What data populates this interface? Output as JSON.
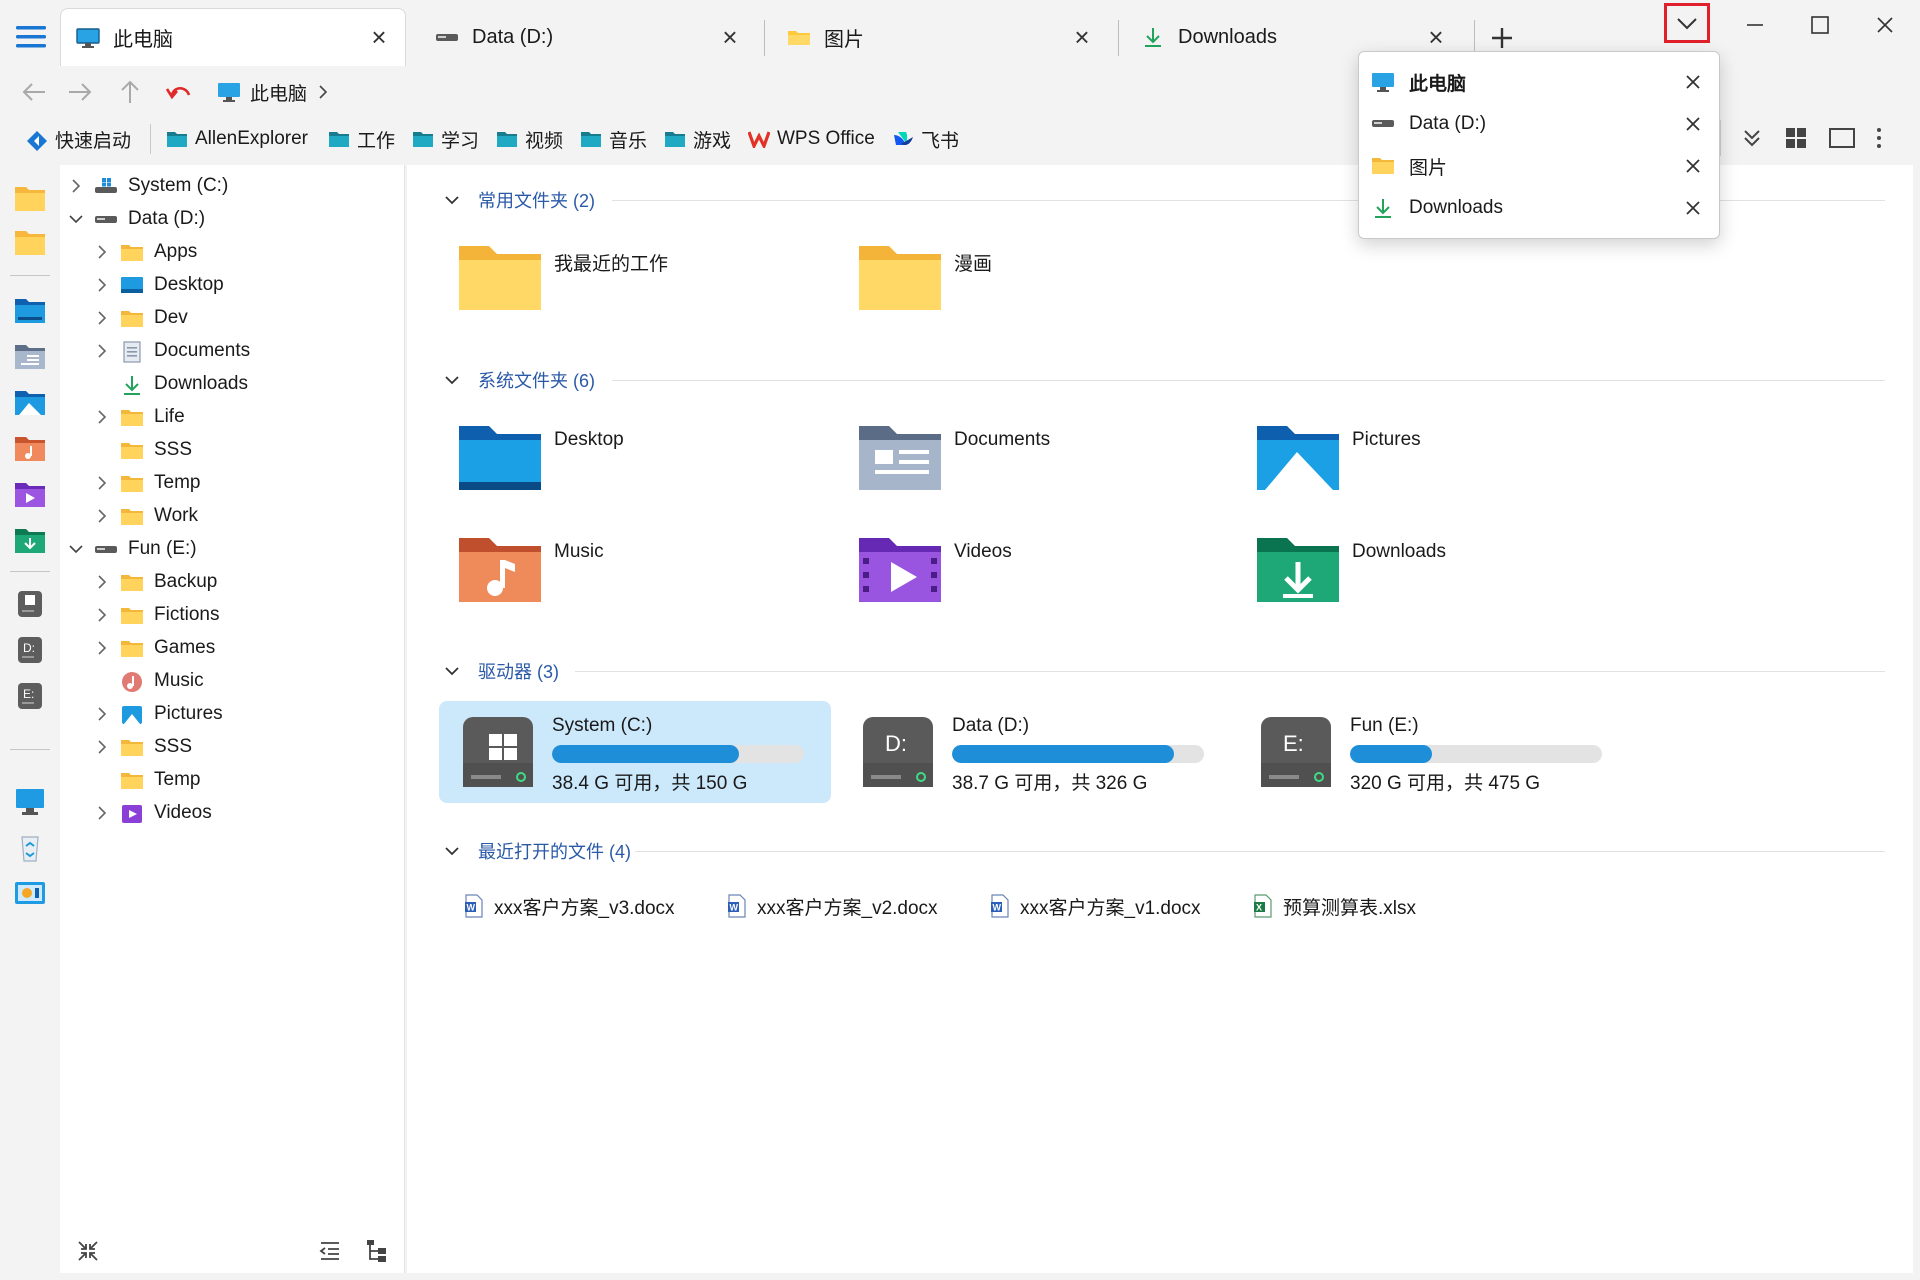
{
  "tabs": [
    {
      "label": "此电脑",
      "icon": "monitor-icon"
    },
    {
      "label": "Data (D:)",
      "icon": "drive-icon"
    },
    {
      "label": "图片",
      "icon": "folder-icon"
    },
    {
      "label": "Downloads",
      "icon": "download-icon"
    }
  ],
  "breadcrumb": {
    "item": "此电脑"
  },
  "quickbar": {
    "quick_start": "快速启动",
    "items": [
      "AllenExplorer",
      "工作",
      "学习",
      "视频",
      "音乐",
      "游戏",
      "WPS Office",
      "飞书"
    ]
  },
  "tree": {
    "drives": [
      {
        "label": "System (C:)"
      },
      {
        "label": "Data (D:)"
      },
      {
        "label": "Fun (E:)"
      }
    ],
    "d_children": [
      "Apps",
      "Desktop",
      "Dev",
      "Documents",
      "Downloads",
      "Life",
      "SSS",
      "Temp",
      "Work"
    ],
    "e_children": [
      "Backup",
      "Fictions",
      "Games",
      "Music",
      "Pictures",
      "SSS",
      "Temp",
      "Videos"
    ]
  },
  "sections": {
    "common": {
      "title": "常用文件夹 (2)",
      "items": [
        "我最近的工作",
        "漫画"
      ]
    },
    "system": {
      "title": "系统文件夹 (6)",
      "items": [
        "Desktop",
        "Documents",
        "Pictures",
        "Music",
        "Videos",
        "Downloads"
      ]
    },
    "drives": {
      "title": "驱动器 (3)",
      "items": [
        {
          "name": "System (C:)",
          "info": "38.4 G 可用，共 150 G",
          "used_fraction": 0.744,
          "letter": ""
        },
        {
          "name": "Data (D:)",
          "info": "38.7 G 可用，共 326 G",
          "used_fraction": 0.881,
          "letter": "D:"
        },
        {
          "name": "Fun (E:)",
          "info": "320 G 可用，共 475 G",
          "used_fraction": 0.326,
          "letter": "E:"
        }
      ]
    },
    "recent": {
      "title": "最近打开的文件 (4)",
      "items": [
        "xxx客户方案_v3.docx",
        "xxx客户方案_v2.docx",
        "xxx客户方案_v1.docx",
        "预算测算表.xlsx"
      ]
    }
  },
  "popup": {
    "items": [
      {
        "label": "此电脑",
        "icon": "monitor-icon"
      },
      {
        "label": "Data (D:)",
        "icon": "drive-icon"
      },
      {
        "label": "图片",
        "icon": "folder-icon"
      },
      {
        "label": "Downloads",
        "icon": "download-icon"
      }
    ]
  },
  "colors": {
    "accent": "#1f8ed8",
    "folder": "#ffc93c",
    "highlight_border": "#e0202a",
    "selected_drive": "#cce8fb",
    "section_text": "#2a59a8"
  }
}
